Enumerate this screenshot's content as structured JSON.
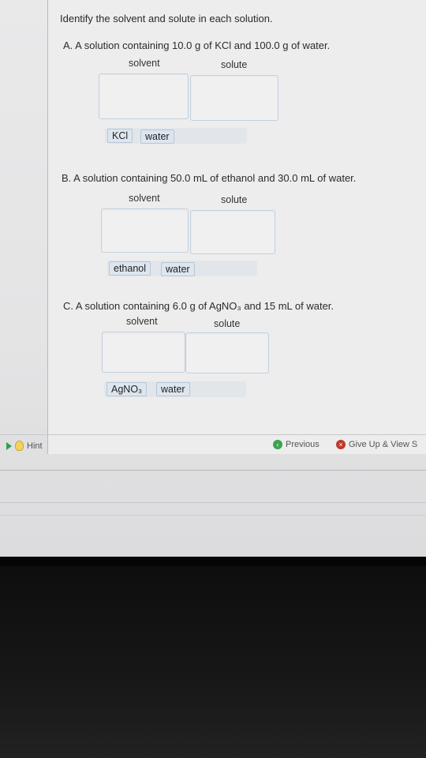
{
  "instructions": "Identify the solvent and solute in each solution.",
  "questions": [
    {
      "text": "A. A solution containing 10.0 g of KCl and 100.0 g of water.",
      "solvent_label": "solvent",
      "solute_label": "solute",
      "chips": [
        "KCl",
        "water"
      ]
    },
    {
      "text": "B. A solution containing 50.0 mL of ethanol and 30.0 mL of water.",
      "solvent_label": "solvent",
      "solute_label": "solute",
      "chips": [
        "ethanol",
        "water"
      ]
    },
    {
      "text": "C. A solution containing 6.0 g of AgNO₃ and 15 mL of water.",
      "solvent_label": "solvent",
      "solute_label": "solute",
      "chips": [
        "AgNO₃",
        "water"
      ]
    }
  ],
  "footer": {
    "hint_label": "Hint",
    "previous_label": "Previous",
    "give_up_label": "Give Up & View S"
  },
  "icons": {
    "hint": "hint-bulb-icon",
    "previous": "previous-arrow-icon",
    "give_up": "give-up-icon"
  }
}
